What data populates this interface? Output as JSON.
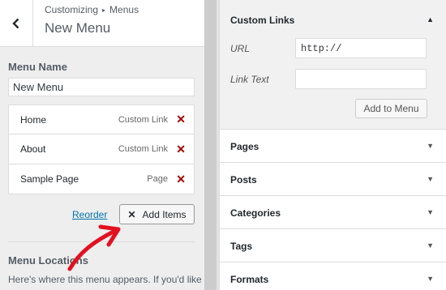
{
  "header": {
    "breadcrumb_root": "Customizing",
    "breadcrumb_sep": "▸",
    "breadcrumb_current": "Menus",
    "title": "New Menu"
  },
  "menu": {
    "name_label": "Menu Name",
    "name_value": "New Menu",
    "items": [
      {
        "title": "Home",
        "type": "Custom Link"
      },
      {
        "title": "About",
        "type": "Custom Link"
      },
      {
        "title": "Sample Page",
        "type": "Page"
      }
    ],
    "reorder_label": "Reorder",
    "add_items_label": "Add Items",
    "locations_label": "Menu Locations",
    "locations_desc": "Here's where this menu appears. If you'd like"
  },
  "custom_links": {
    "title": "Custom Links",
    "url_label": "URL",
    "url_value": "http://",
    "link_text_label": "Link Text",
    "link_text_value": "",
    "add_button": "Add to Menu"
  },
  "sections": [
    {
      "title": "Pages"
    },
    {
      "title": "Posts"
    },
    {
      "title": "Categories"
    },
    {
      "title": "Tags"
    },
    {
      "title": "Formats"
    }
  ],
  "colors": {
    "link": "#0073aa",
    "remove": "#aa0000",
    "annotation_arrow": "#e3101f"
  }
}
